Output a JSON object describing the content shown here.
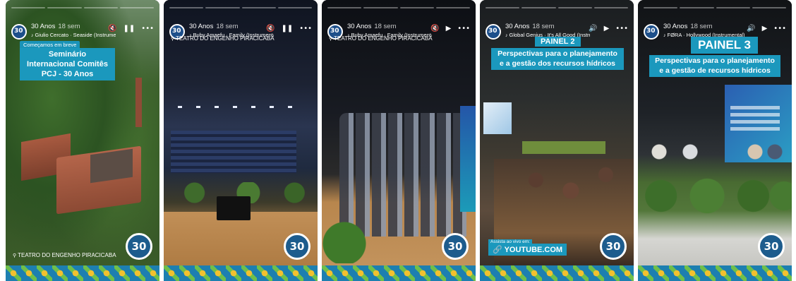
{
  "account_name": "30 Anos",
  "posted_ago": "18 sem",
  "badge_text": "30",
  "stories": [
    {
      "music": "Giulio Cercato · Seaside (Instrumental)",
      "controls": [
        "🔇",
        "❚❚",
        "•••"
      ],
      "tag": "Começamos em breve",
      "caption": "Seminário Internacional Comitês PCJ - 30 Anos",
      "location": "TEATRO DO ENGENHO PIRACICABA"
    },
    {
      "music": "Buby Amaefu · Family (Instrumental)",
      "controls": [
        "🔇",
        "❚❚",
        "•••"
      ],
      "location": "TEATRO DO ENGENHO PIRACICABA"
    },
    {
      "music": "Buby Amaefu · Family (Instrumental)",
      "controls": [
        "🔇",
        "▶",
        "•••"
      ],
      "location": "TEATRO DO ENGENHO PIRACICABA"
    },
    {
      "music": "Global Genius · It's All Good (Instrum",
      "controls": [
        "🔊",
        "▶",
        "•••"
      ],
      "painel": "PAINEL 2",
      "caption": "Perspectivas para o planejamento e a gestão dos recursos hídricos",
      "live_note": "Assista ao vivo em:",
      "link": "YOUTUBE.COM"
    },
    {
      "music": "FØRA · Hollywood (Instrumental)",
      "controls": [
        "🔊",
        "▶",
        "•••"
      ],
      "painel": "PAINEL 3",
      "caption": "Perspectivas para o planejamento e a gestão de recursos hídricos"
    }
  ]
}
